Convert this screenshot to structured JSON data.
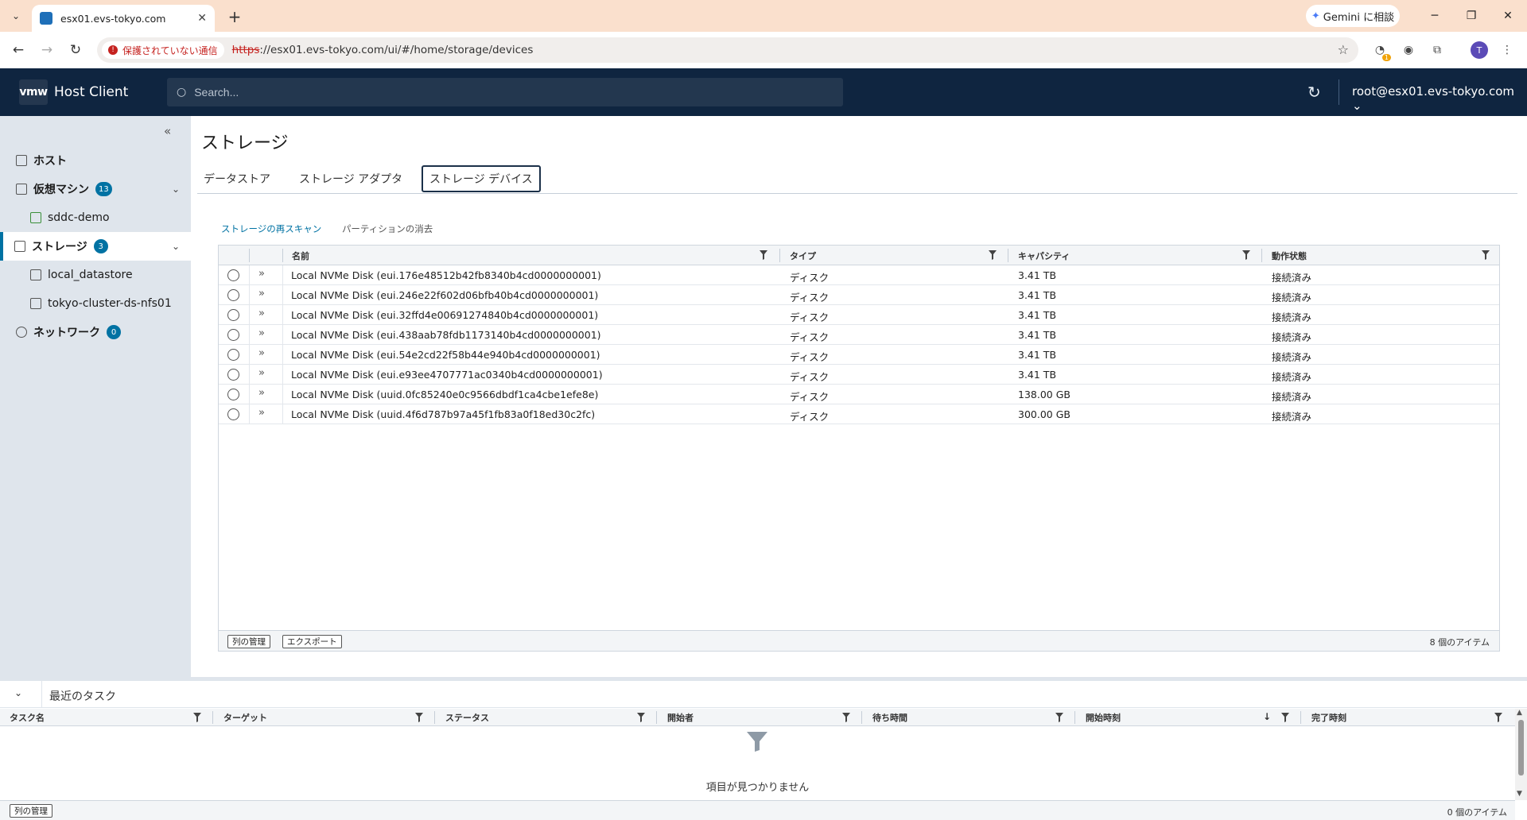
{
  "browser": {
    "tab_title": "esx01.evs-tokyo.com",
    "gemini_label": "Gemini に相談",
    "security_label": "保護されていない通信",
    "url_scheme": "https",
    "url_rest": "://esx01.evs-tokyo.com/ui/#/home/storage/devices",
    "profile_initial": "T",
    "ext_badge": "1"
  },
  "header": {
    "logo": "vmw",
    "app_name": "Host Client",
    "search_placeholder": "Search...",
    "user": "root@esx01.evs-tokyo.com"
  },
  "sidebar": {
    "items": [
      {
        "label": "ホスト"
      },
      {
        "label": "仮想マシン",
        "badge": "13"
      },
      {
        "label": "sddc-demo"
      },
      {
        "label": "ストレージ",
        "badge": "3"
      },
      {
        "label": "local_datastore"
      },
      {
        "label": "tokyo-cluster-ds-nfs01"
      },
      {
        "label": "ネットワーク",
        "badge": "0"
      }
    ]
  },
  "page": {
    "title": "ストレージ",
    "tabs": [
      "データストア",
      "ストレージ アダプタ",
      "ストレージ デバイス"
    ],
    "actions": [
      "ストレージの再スキャン",
      "パーティションの消去"
    ]
  },
  "grid": {
    "columns": [
      "名前",
      "タイプ",
      "キャパシティ",
      "動作状態"
    ],
    "rows": [
      {
        "name": "Local NVMe Disk (eui.176e48512b42fb8340b4cd0000000001)",
        "type": "ディスク",
        "capacity": "3.41 TB",
        "status": "接続済み"
      },
      {
        "name": "Local NVMe Disk (eui.246e22f602d06bfb40b4cd0000000001)",
        "type": "ディスク",
        "capacity": "3.41 TB",
        "status": "接続済み"
      },
      {
        "name": "Local NVMe Disk (eui.32ffd4e00691274840b4cd0000000001)",
        "type": "ディスク",
        "capacity": "3.41 TB",
        "status": "接続済み"
      },
      {
        "name": "Local NVMe Disk (eui.438aab78fdb1173140b4cd0000000001)",
        "type": "ディスク",
        "capacity": "3.41 TB",
        "status": "接続済み"
      },
      {
        "name": "Local NVMe Disk (eui.54e2cd22f58b44e940b4cd0000000001)",
        "type": "ディスク",
        "capacity": "3.41 TB",
        "status": "接続済み"
      },
      {
        "name": "Local NVMe Disk (eui.e93ee4707771ac0340b4cd0000000001)",
        "type": "ディスク",
        "capacity": "3.41 TB",
        "status": "接続済み"
      },
      {
        "name": "Local NVMe Disk (uuid.0fc85240e0c9566dbdf1ca4cbe1efe8e)",
        "type": "ディスク",
        "capacity": "138.00 GB",
        "status": "接続済み"
      },
      {
        "name": "Local NVMe Disk (uuid.4f6d787b97a45f1fb83a0f18ed30c2fc)",
        "type": "ディスク",
        "capacity": "300.00 GB",
        "status": "接続済み"
      }
    ],
    "footer": {
      "manage_cols": "列の管理",
      "export": "エクスポート",
      "count": "8 個のアイテム"
    }
  },
  "tasks": {
    "title": "最近のタスク",
    "columns": [
      "タスク名",
      "ターゲット",
      "ステータス",
      "開始者",
      "待ち時間",
      "開始時刻",
      "完了時刻"
    ],
    "empty": "項目が見つかりません",
    "manage_cols": "列の管理",
    "count": "0 個のアイテム"
  }
}
